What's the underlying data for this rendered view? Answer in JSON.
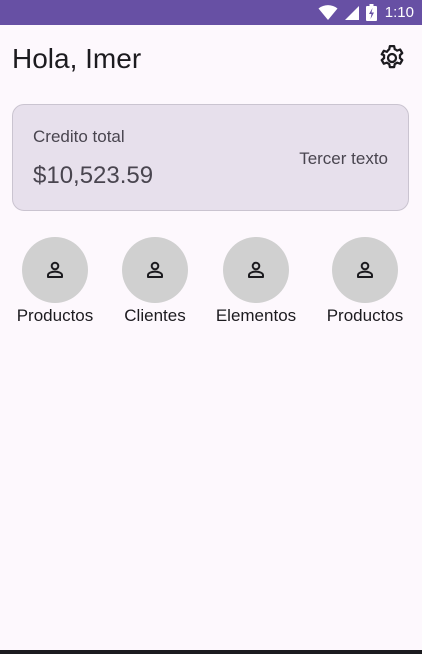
{
  "status_bar": {
    "time": "1:10",
    "icons": [
      "wifi-icon",
      "signal-icon",
      "battery-icon"
    ],
    "color": "#6750a4"
  },
  "header": {
    "greeting": "Hola, Imer",
    "settings_icon": "gear-icon"
  },
  "credit_card": {
    "label": "Credito total",
    "amount": "$10,523.59",
    "third_text": "Tercer texto"
  },
  "shortcuts": [
    {
      "label": "Productos",
      "icon": "person-icon"
    },
    {
      "label": "Clientes",
      "icon": "person-icon"
    },
    {
      "label": "Elementos",
      "icon": "person-icon"
    },
    {
      "label": "Productos",
      "icon": "person-icon"
    }
  ]
}
